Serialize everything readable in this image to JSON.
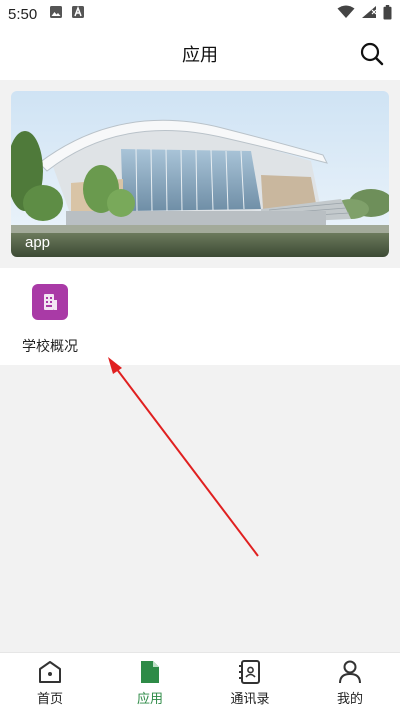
{
  "status_bar": {
    "time": "5:50"
  },
  "header": {
    "title": "应用",
    "search_icon": "search-icon"
  },
  "banner": {
    "label": "app"
  },
  "apps": [
    {
      "label": "学校概况",
      "icon": "building-icon",
      "color": "#a93aa6"
    }
  ],
  "bottom_nav": {
    "items": [
      {
        "label": "首页",
        "icon": "home-icon",
        "active": false
      },
      {
        "label": "应用",
        "icon": "document-icon",
        "active": true
      },
      {
        "label": "通讯录",
        "icon": "contacts-icon",
        "active": false
      },
      {
        "label": "我的",
        "icon": "user-icon",
        "active": false
      }
    ],
    "active_color": "#2e8b47"
  },
  "colors": {
    "annotation_arrow": "#e02020",
    "background": "#f2f2f2"
  }
}
